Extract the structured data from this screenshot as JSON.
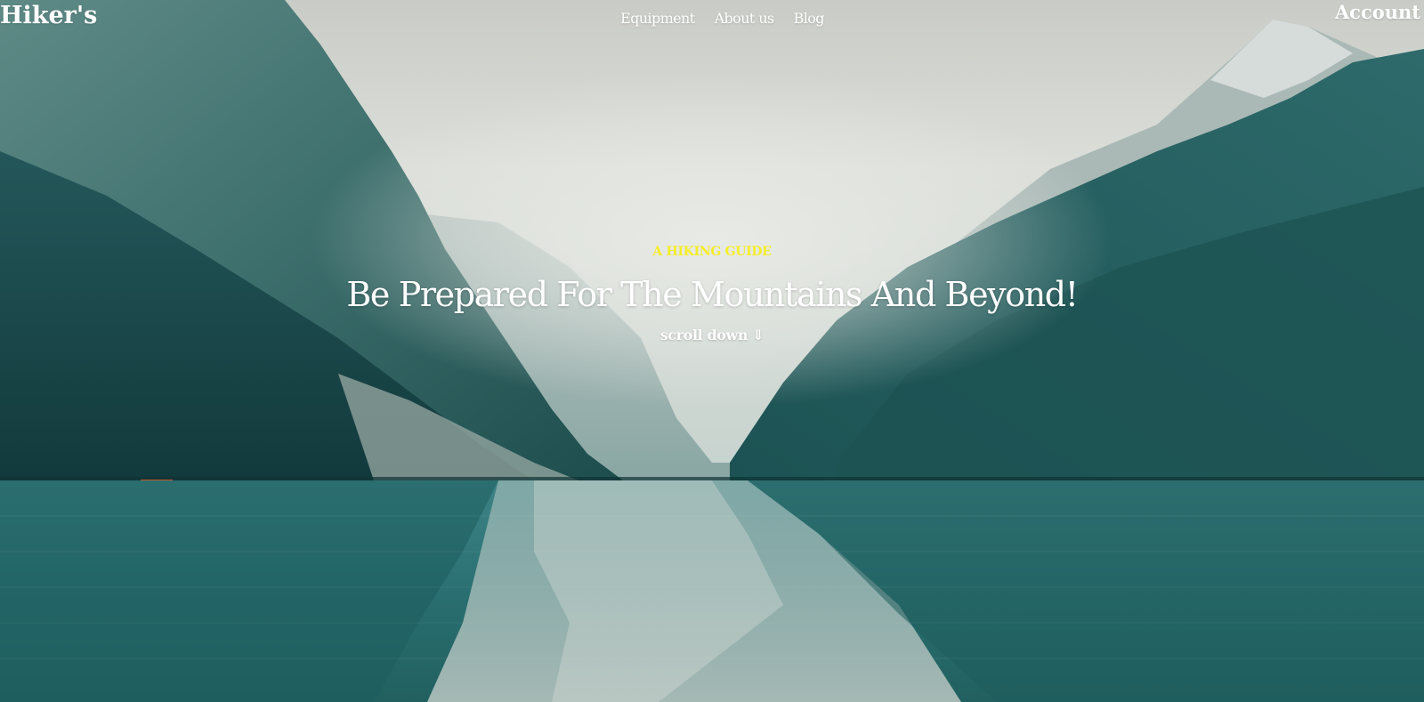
{
  "header": {
    "logo": "Hiker's",
    "nav": [
      {
        "label": "Equipment"
      },
      {
        "label": "About us"
      },
      {
        "label": "Blog"
      }
    ],
    "account_label": "Account"
  },
  "hero": {
    "eyebrow": "A HIKING GUIDE",
    "headline": "Be Prepared For The Mountains And Beyond!",
    "scroll_label": "scroll down ⇓"
  },
  "colors": {
    "eyebrow": "#f6ee25",
    "text": "#ffffff",
    "water": "#2e7576",
    "sky": "#d9dcd6"
  }
}
